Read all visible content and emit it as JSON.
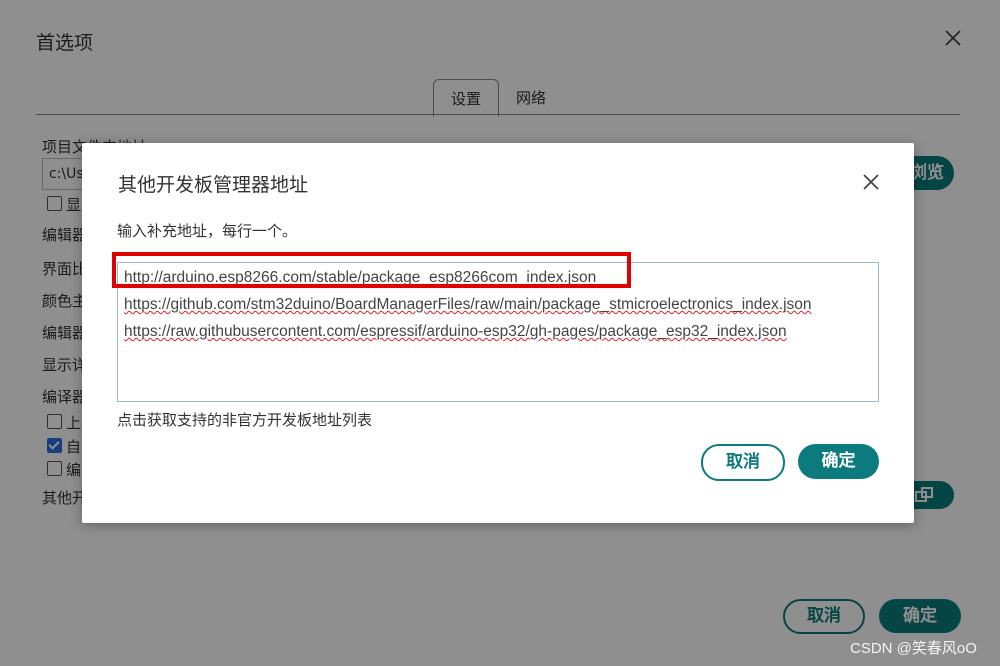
{
  "preferences": {
    "title": "首选项",
    "tabs": [
      {
        "label": "设置",
        "active": true
      },
      {
        "label": "网络",
        "active": false
      }
    ],
    "labels": [
      "项目文件夹地址",
      "编辑器",
      "界面比",
      "颜色主",
      "编辑器",
      "显示详",
      "编译器",
      "其他开"
    ],
    "path_value": "c:\\Us",
    "checkbox_labels": [
      "显",
      "上",
      "自",
      "编"
    ],
    "browse_button": "浏览",
    "cancel_button": "取消",
    "ok_button": "确定"
  },
  "dialog": {
    "title": "其他开发板管理器地址",
    "hint": "输入补充地址，每行一个。",
    "urls": [
      "http://arduino.esp8266.com/stable/package_esp8266com_index.json",
      "https://github.com/stm32duino/BoardManagerFiles/raw/main/package_stmicroelectronics_index.json",
      "https://raw.githubusercontent.com/espressif/arduino-esp32/gh-pages/package_esp32_index.json"
    ],
    "link_text": "点击获取支持的非官方开发板地址列表",
    "cancel_button": "取消",
    "ok_button": "确定"
  },
  "colors": {
    "accent": "#0b7b7e",
    "highlight": "#e00000"
  },
  "watermark": "CSDN @笑春风oO"
}
